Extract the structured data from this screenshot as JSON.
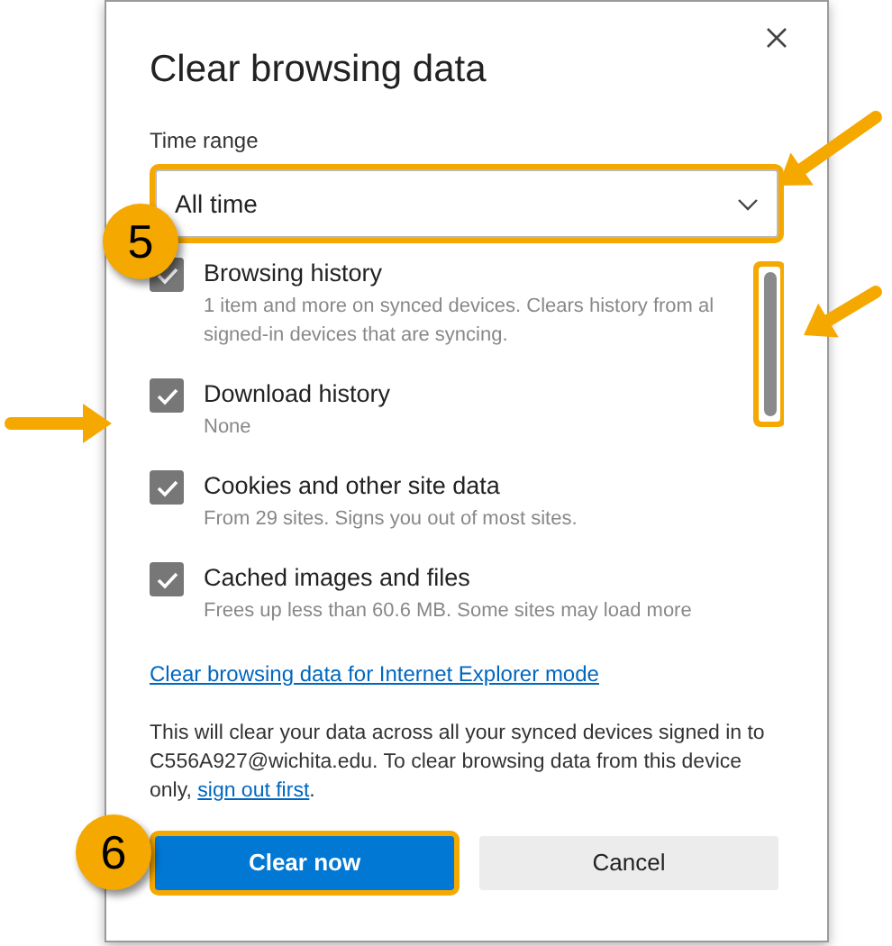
{
  "dialog": {
    "title": "Clear browsing data",
    "time_range": {
      "label": "Time range",
      "value": "All time",
      "highlighted": true
    },
    "items": [
      {
        "title": "Browsing history",
        "description": "1 item and more on synced devices. Clears history from al signed-in devices that are syncing.",
        "checked": true
      },
      {
        "title": "Download history",
        "description": "None",
        "checked": true
      },
      {
        "title": "Cookies and other site data",
        "description": "From 29 sites. Signs you out of most sites.",
        "checked": true
      },
      {
        "title": "Cached images and files",
        "description": "Frees up less than 60.6 MB. Some sites may load more",
        "checked": true
      }
    ],
    "scrollbar": {
      "highlighted": true
    },
    "ie_link": "Clear browsing data for Internet Explorer mode",
    "notice": {
      "text": "This will clear your data across all your synced devices signed in to C556A927@wichita.edu. To clear browsing data from this device only, ",
      "link": "sign out first",
      "end": "."
    },
    "buttons": [
      {
        "label": "Clear now",
        "kind": "primary",
        "highlighted": true
      },
      {
        "label": "Cancel",
        "kind": "secondary",
        "highlighted": false
      }
    ]
  },
  "callouts": [
    "5",
    "6"
  ]
}
